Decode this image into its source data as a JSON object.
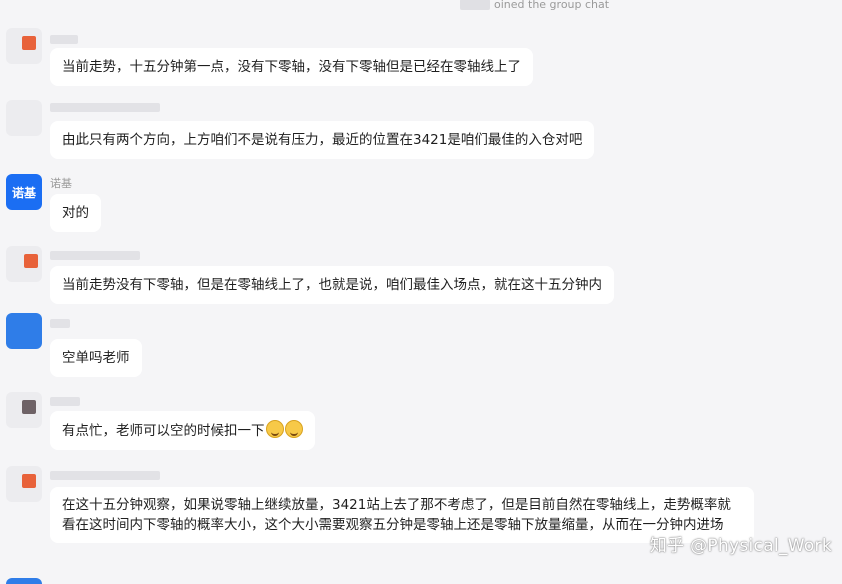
{
  "system_notice": {
    "text": "oined the group chat"
  },
  "messages": [
    {
      "sender": "",
      "text": "当前走势，十五分钟第一点，没有下零轴，没有下零轴但是已经在零轴线上了"
    },
    {
      "sender": "",
      "text": "由此只有两个方向，上方咱们不是说有压力，最近的位置在3421是咱们最佳的入仓对吧"
    },
    {
      "sender": "诺基",
      "avatar_text": "诺基",
      "text": "对的"
    },
    {
      "sender": "",
      "text": "当前走势没有下零轴，但是在零轴线上了，也就是说，咱们最佳入场点，就在这十五分钟内"
    },
    {
      "sender": "",
      "text": "空单吗老师"
    },
    {
      "sender": "",
      "text": "有点忙，老师可以空的时候扣一下"
    },
    {
      "sender": "",
      "text": "在这十五分钟观察，如果说零轴上继续放量，3421站上去了那不考虑了，但是目前自然在零轴线上，走势概率就看在这时间内下零轴的概率大小，这个大小需要观察五分钟是零轴上还是零轴下放量缩量，从而在一分钟内进场"
    }
  ],
  "watermark": "知乎 @Physical_Work",
  "colors": {
    "background": "#f5f5f7",
    "bubble": "#ffffff",
    "avatar_blue": "#1b6ef3"
  }
}
